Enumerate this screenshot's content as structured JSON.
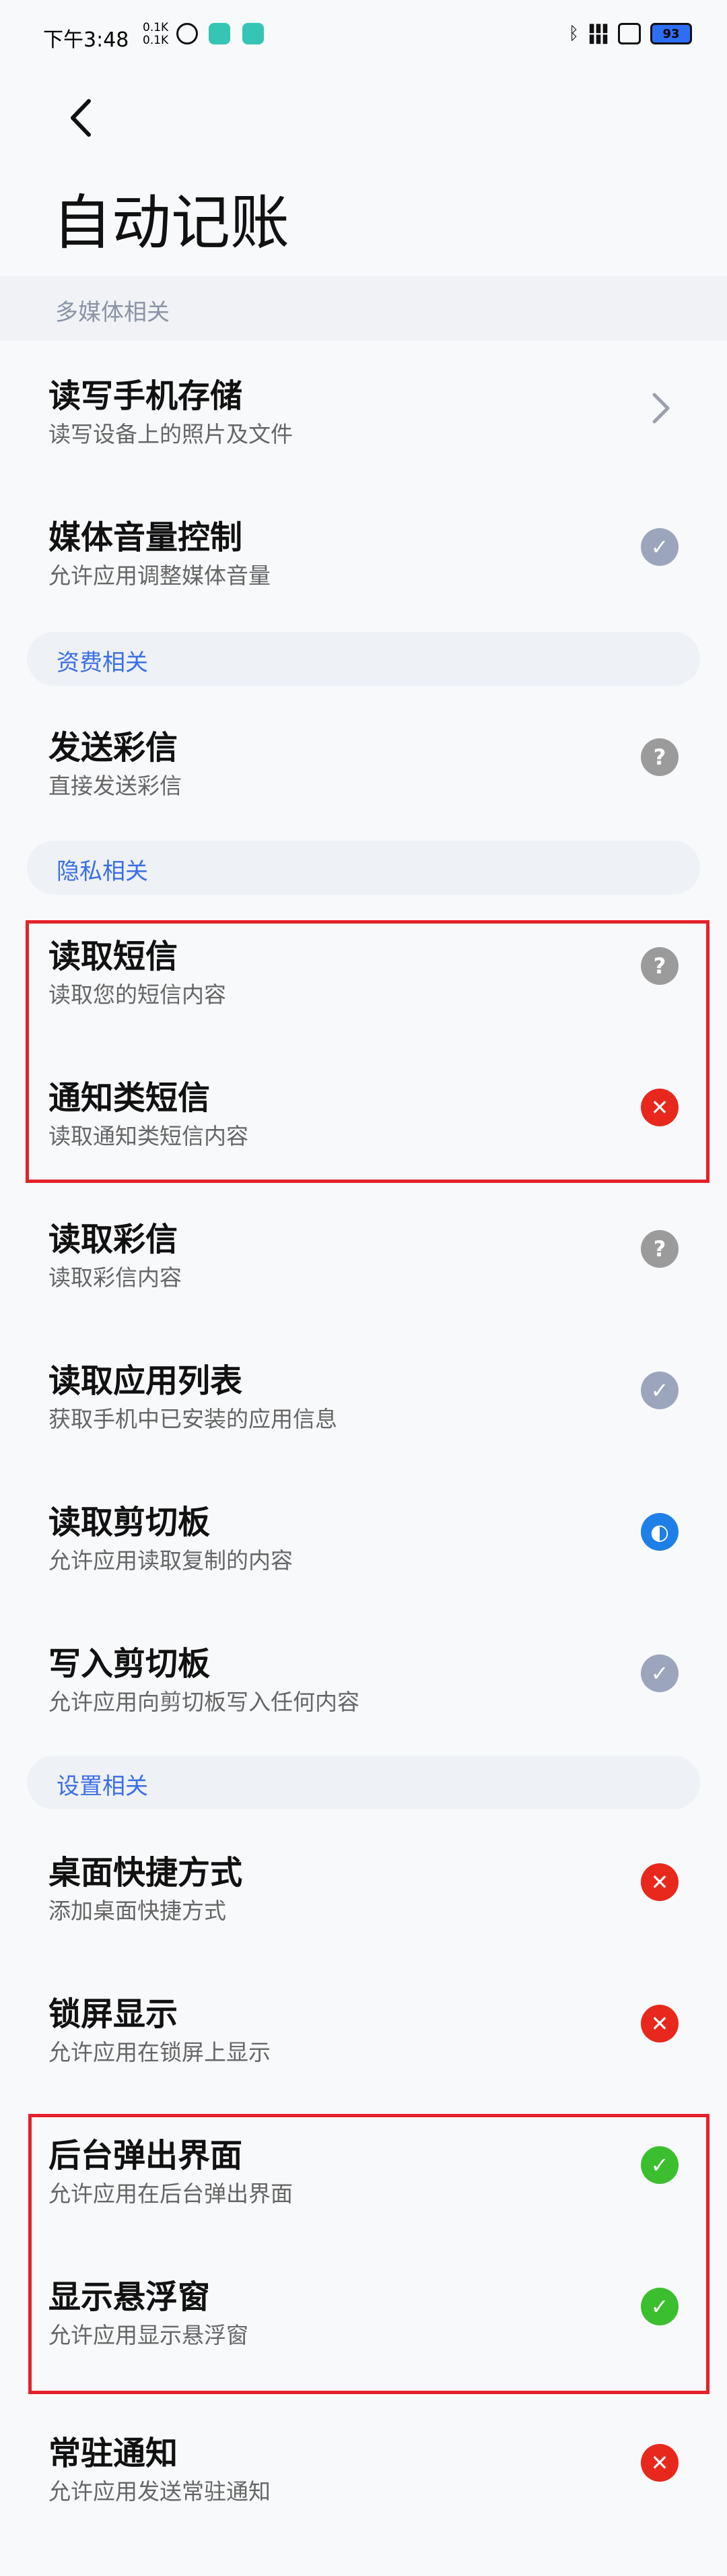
{
  "status_bar": {
    "time": "下午3:48",
    "speed_up": "0.1K",
    "speed_down": "0.1K",
    "battery": "93"
  },
  "page": {
    "title": "自动记账"
  },
  "sections": {
    "multimedia": "多媒体相关",
    "billing": "资费相关",
    "privacy": "隐私相关",
    "settings": "设置相关"
  },
  "rows": [
    {
      "title": "读写手机存储",
      "desc": "读写设备上的照片及文件",
      "status": "chevron"
    },
    {
      "title": "媒体音量控制",
      "desc": "允许应用调整媒体音量",
      "status": "ok"
    },
    {
      "title": "发送彩信",
      "desc": "直接发送彩信",
      "status": "question"
    },
    {
      "title": "读取短信",
      "desc": "读取您的短信内容",
      "status": "question"
    },
    {
      "title": "通知类短信",
      "desc": "读取通知类短信内容",
      "status": "denied"
    },
    {
      "title": "读取彩信",
      "desc": "读取彩信内容",
      "status": "question"
    },
    {
      "title": "读取应用列表",
      "desc": "获取手机中已安装的应用信息",
      "status": "ok"
    },
    {
      "title": "读取剪切板",
      "desc": "允许应用读取复制的内容",
      "status": "info"
    },
    {
      "title": "写入剪切板",
      "desc": "允许应用向剪切板写入任何内容",
      "status": "ok"
    },
    {
      "title": "桌面快捷方式",
      "desc": "添加桌面快捷方式",
      "status": "denied"
    },
    {
      "title": "锁屏显示",
      "desc": "允许应用在锁屏上显示",
      "status": "denied"
    },
    {
      "title": "后台弹出界面",
      "desc": "允许应用在后台弹出界面",
      "status": "allowed"
    },
    {
      "title": "显示悬浮窗",
      "desc": "允许应用显示悬浮窗",
      "status": "allowed"
    },
    {
      "title": "常驻通知",
      "desc": "允许应用发送常驻通知",
      "status": "denied"
    }
  ],
  "symbols": {
    "question": "?",
    "denied": "✕",
    "allowed": "✓",
    "ok": "✓",
    "info": "◐"
  },
  "colors": {
    "accent": "#3c6fe6",
    "denied": "#e8281d",
    "allowed": "#3bbf2f",
    "info": "#1e7fe8",
    "highlight": "#e4212a"
  }
}
